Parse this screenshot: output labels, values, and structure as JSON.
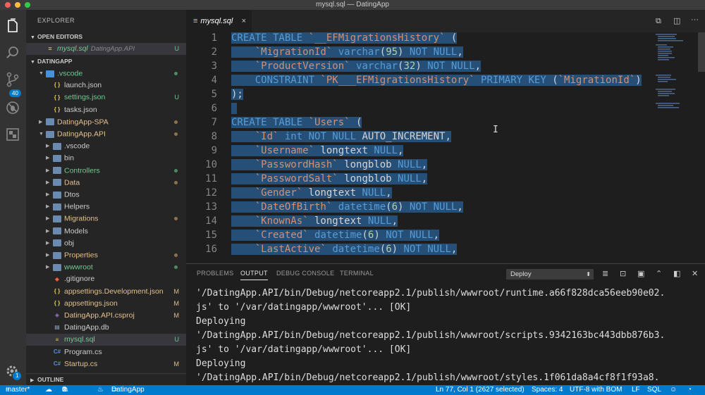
{
  "window": {
    "title": "mysql.sql — DatingApp"
  },
  "activity": {
    "scm_badge": "40",
    "settings_badge": "1"
  },
  "sidebar": {
    "title": "EXPLORER",
    "open_editors_label": "OPEN EDITORS",
    "open_editor": {
      "name": "mysql.sql",
      "path": "DatingApp.API",
      "status": "U"
    },
    "project_label": "DATINGAPP",
    "tree": [
      {
        "label": ".vscode",
        "depth": 1,
        "kind": "folder-open",
        "color": "#73c991",
        "status": "dot-green"
      },
      {
        "label": "launch.json",
        "depth": 2,
        "kind": "json",
        "color": "#ccc",
        "status": ""
      },
      {
        "label": "settings.json",
        "depth": 2,
        "kind": "json",
        "color": "#73c991",
        "status": "U"
      },
      {
        "label": "tasks.json",
        "depth": 2,
        "kind": "json",
        "color": "#ccc",
        "status": ""
      },
      {
        "label": "DatingApp-SPA",
        "depth": 1,
        "kind": "folder-closed",
        "color": "#e2c08d",
        "status": "dot-orange"
      },
      {
        "label": "DatingApp.API",
        "depth": 1,
        "kind": "folder-open",
        "color": "#e2c08d",
        "status": "dot-orange"
      },
      {
        "label": ".vscode",
        "depth": 2,
        "kind": "folder-closed",
        "color": "#ccc",
        "status": ""
      },
      {
        "label": "bin",
        "depth": 2,
        "kind": "folder-closed",
        "color": "#ccc",
        "status": ""
      },
      {
        "label": "Controllers",
        "depth": 2,
        "kind": "folder-closed",
        "color": "#73c991",
        "status": "dot-green"
      },
      {
        "label": "Data",
        "depth": 2,
        "kind": "folder-closed",
        "color": "#e2c08d",
        "status": "dot-orange"
      },
      {
        "label": "Dtos",
        "depth": 2,
        "kind": "folder-closed",
        "color": "#ccc",
        "status": ""
      },
      {
        "label": "Helpers",
        "depth": 2,
        "kind": "folder-closed",
        "color": "#ccc",
        "status": ""
      },
      {
        "label": "Migrations",
        "depth": 2,
        "kind": "folder-closed",
        "color": "#e2c08d",
        "status": "dot-orange"
      },
      {
        "label": "Models",
        "depth": 2,
        "kind": "folder-closed",
        "color": "#ccc",
        "status": ""
      },
      {
        "label": "obj",
        "depth": 2,
        "kind": "folder-closed",
        "color": "#ccc",
        "status": ""
      },
      {
        "label": "Properties",
        "depth": 2,
        "kind": "folder-closed",
        "color": "#e2c08d",
        "status": "dot-orange"
      },
      {
        "label": "wwwroot",
        "depth": 2,
        "kind": "folder-closed",
        "color": "#73c991",
        "status": "dot-green"
      },
      {
        "label": ".gitignore",
        "depth": 2,
        "kind": "git",
        "color": "#ccc",
        "status": ""
      },
      {
        "label": "appsettings.Development.json",
        "depth": 2,
        "kind": "json",
        "color": "#e2c08d",
        "status": "M"
      },
      {
        "label": "appsettings.json",
        "depth": 2,
        "kind": "json",
        "color": "#e2c08d",
        "status": "M"
      },
      {
        "label": "DatingApp.API.csproj",
        "depth": 2,
        "kind": "csproj",
        "color": "#e2c08d",
        "status": "M"
      },
      {
        "label": "DatingApp.db",
        "depth": 2,
        "kind": "db",
        "color": "#ccc",
        "status": ""
      },
      {
        "label": "mysql.sql",
        "depth": 2,
        "kind": "sql",
        "color": "#73c991",
        "status": "U"
      },
      {
        "label": "Program.cs",
        "depth": 2,
        "kind": "cs",
        "color": "#ccc",
        "status": ""
      },
      {
        "label": "Startup.cs",
        "depth": 2,
        "kind": "cs",
        "color": "#e2c08d",
        "status": "M"
      }
    ],
    "outline_label": "OUTLINE"
  },
  "editor": {
    "tab_label": "mysql.sql",
    "tab_close": "×",
    "line_numbers": [
      "1",
      "2",
      "3",
      "4",
      "5",
      "6",
      "7",
      "8",
      "9",
      "10",
      "11",
      "12",
      "13",
      "14",
      "15",
      "16"
    ]
  },
  "panel": {
    "tabs": [
      "PROBLEMS",
      "OUTPUT",
      "DEBUG CONSOLE",
      "TERMINAL"
    ],
    "active_tab": "OUTPUT",
    "selected_channel": "Deploy",
    "lines": [
      "'/DatingApp.API/bin/Debug/netcoreapp2.1/publish/wwwroot/runtime.a66f828dca56eeb90e02.",
      "js' to '/var/datingapp/wwwroot'... [OK]",
      "Deploying",
      "'/DatingApp.API/bin/Debug/netcoreapp2.1/publish/wwwroot/scripts.9342163bc443dbb876b3.",
      "js' to '/var/datingapp/wwwroot'... [OK]",
      "Deploying",
      "'/DatingApp.API/bin/Debug/netcoreapp2.1/publish/wwwroot/styles.1f061da8a4cf8f1f93a8."
    ]
  },
  "status": {
    "branch": "master*",
    "errors": "0",
    "warnings": "0",
    "project": "DatingApp",
    "position": "Ln 77, Col 1 (2627 selected)",
    "spaces": "Spaces: 4",
    "encoding": "UTF-8 with BOM",
    "eol": "LF",
    "language": "SQL"
  },
  "colors": {
    "accent": "#007acc",
    "selection": "#264f78",
    "untracked": "#73c991",
    "modified": "#e2c08d"
  }
}
